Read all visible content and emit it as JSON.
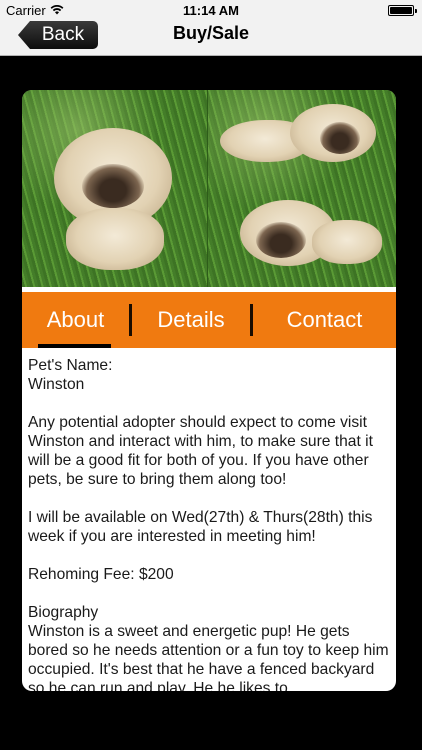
{
  "status_bar": {
    "carrier": "Carrier",
    "time": "11:14 AM"
  },
  "nav": {
    "back_label": "Back",
    "title": "Buy/Sale"
  },
  "tabs": [
    {
      "label": "About",
      "active": true
    },
    {
      "label": "Details",
      "active": false
    },
    {
      "label": "Contact",
      "active": false
    }
  ],
  "content": {
    "pet_name_label": "Pet's Name:",
    "pet_name": "Winston",
    "paragraph_visit": "Any potential adopter should expect to come visit Winston and interact with him, to make sure that it will be a good fit for both of you. If you have other pets, be sure to bring them along too!",
    "paragraph_availability": "I will be available on Wed(27th) & Thurs(28th) this week if you are interested in meeting him!",
    "rehoming_fee": "Rehoming Fee: $200",
    "biography_label": "Biography",
    "biography_text": "Winston is a sweet and energetic pup! He gets bored so he needs attention or a fun toy to keep him occupied. It's best that he have a fenced backyard so he can run and play. He he likes to"
  },
  "colors": {
    "accent": "#f07a10",
    "nav_background": "#f2f2f2",
    "screen_background": "#000000"
  },
  "icons": {
    "wifi": "wifi-icon",
    "battery": "battery-icon",
    "back": "back-chevron"
  }
}
